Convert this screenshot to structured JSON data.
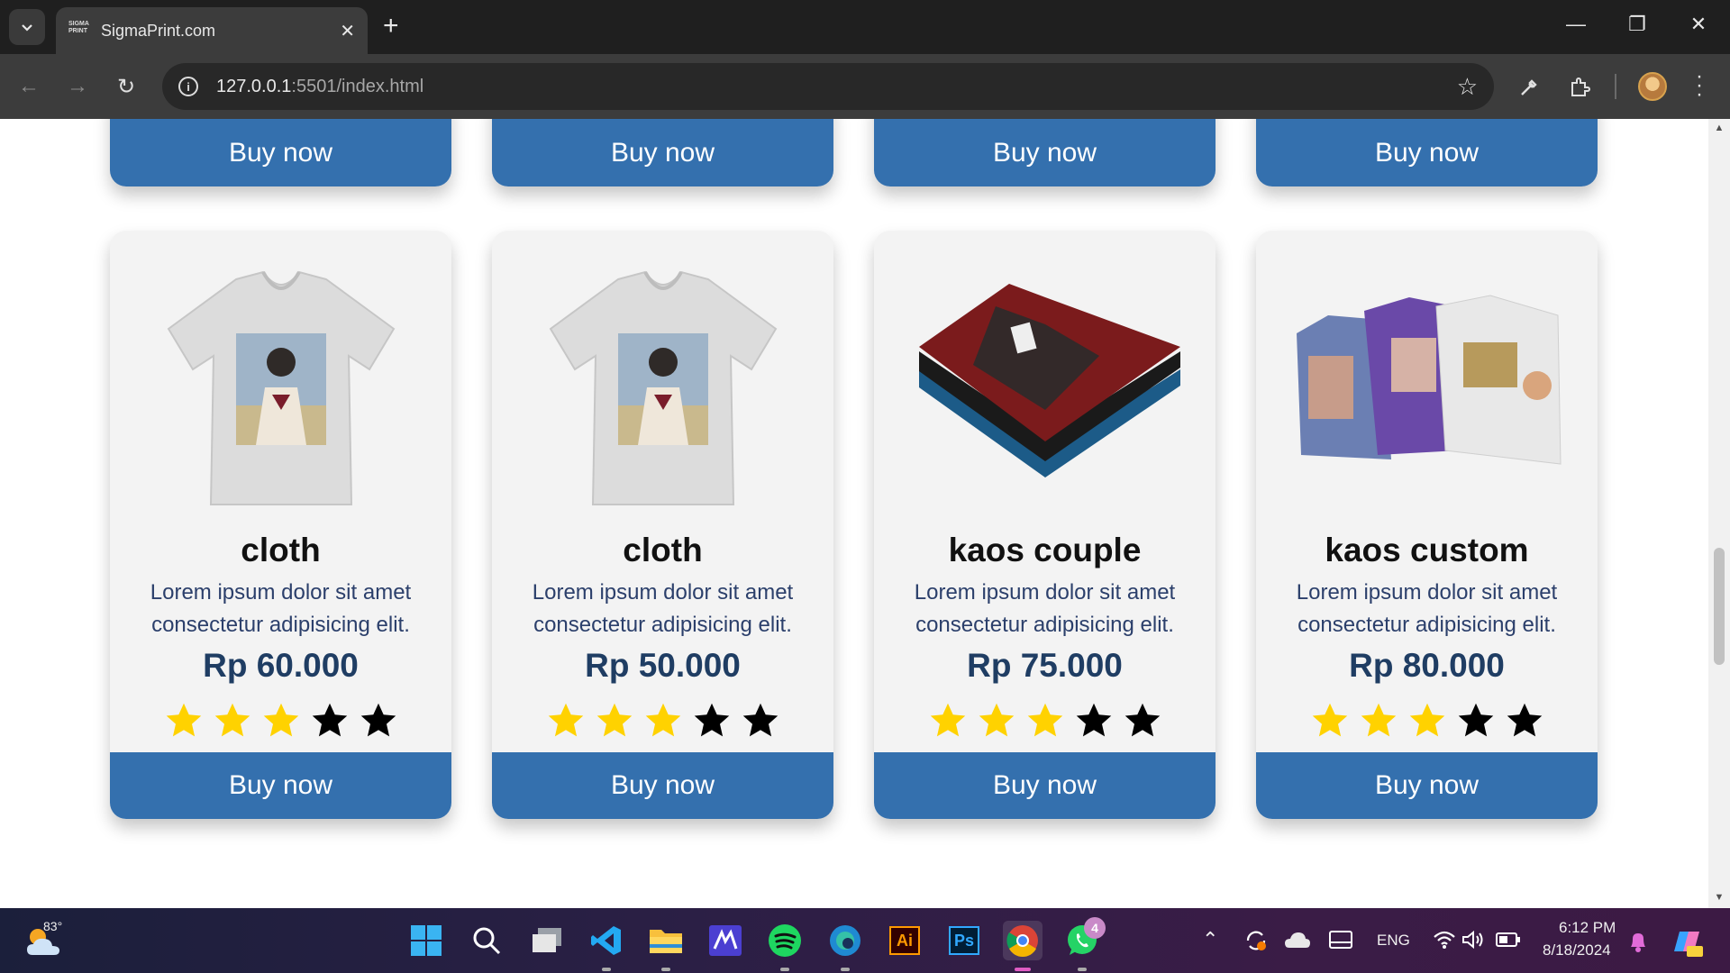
{
  "browser": {
    "tab_title": "SigmaPrint.com",
    "favicon_text": "SIGMA PRINT",
    "url_host": "127.0.0.1",
    "url_rest": ":5501/index.html"
  },
  "top_row": {
    "buttons": [
      "Buy now",
      "Buy now",
      "Buy now",
      "Buy now"
    ]
  },
  "products": [
    {
      "name": "cloth",
      "description": "Lorem ipsum dolor sit amet consectetur adipisicing elit.",
      "price": "Rp 60.000",
      "rating": 3,
      "max_rating": 5,
      "button": "Buy now",
      "image": "grey-vneck-tshirt-photo-print"
    },
    {
      "name": "cloth",
      "description": "Lorem ipsum dolor sit amet consectetur adipisicing elit.",
      "price": "Rp 50.000",
      "rating": 3,
      "max_rating": 5,
      "button": "Buy now",
      "image": "grey-vneck-tshirt-photo-print"
    },
    {
      "name": "kaos couple",
      "description": "Lorem ipsum dolor sit amet consectetur adipisicing elit.",
      "price": "Rp 75.000",
      "rating": 3,
      "max_rating": 5,
      "button": "Buy now",
      "image": "folded-red-tshirt-stack"
    },
    {
      "name": "kaos custom",
      "description": "Lorem ipsum dolor sit amet consectetur adipisicing elit.",
      "price": "Rp 80.000",
      "rating": 3,
      "max_rating": 5,
      "button": "Buy now",
      "image": "three-custom-tshirts"
    }
  ],
  "colors": {
    "button": "#3470ae",
    "card_bg": "#f3f3f3",
    "price": "#1f3d63",
    "description": "#2b3f6b",
    "star_filled": "#ffd200",
    "star_empty": "#000000"
  },
  "taskbar": {
    "weather_temp": "83°",
    "language": "ENG",
    "time": "6:12 PM",
    "date": "8/18/2024",
    "whatsapp_badge": "4",
    "apps": [
      "windows-start",
      "search",
      "task-view",
      "vscode",
      "file-explorer",
      "app-m",
      "spotify",
      "edge",
      "illustrator",
      "photoshop",
      "chrome",
      "whatsapp"
    ],
    "illustrator_label": "Ai",
    "photoshop_label": "Ps"
  }
}
